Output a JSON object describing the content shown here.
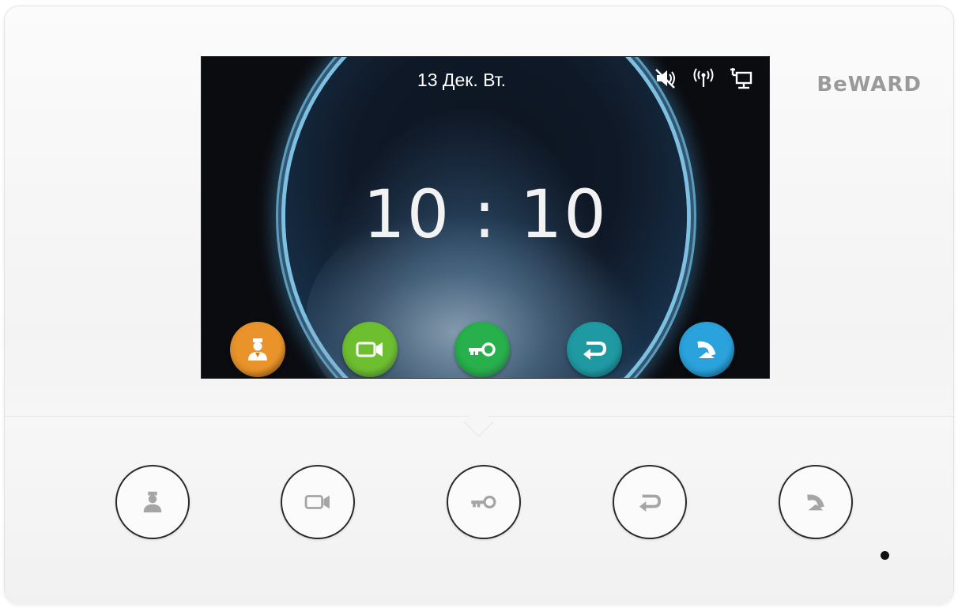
{
  "brand": "BeWARD",
  "screen": {
    "date": "13 Дек. Вт.",
    "time": "10 : 10",
    "status_icons": [
      "mute-icon",
      "wireless-antenna-icon",
      "network-lan-icon"
    ]
  },
  "screen_buttons": [
    {
      "name": "concierge",
      "icon": "concierge-icon",
      "color": "#e9932a"
    },
    {
      "name": "monitor",
      "icon": "video-camera-icon",
      "color": "#6dbf2f"
    },
    {
      "name": "unlock",
      "icon": "key-icon",
      "color": "#27b04b"
    },
    {
      "name": "transfer",
      "icon": "transfer-icon",
      "color": "#1f9aa2"
    },
    {
      "name": "hang-up",
      "icon": "hang-up-icon",
      "color": "#2aa2dc"
    }
  ],
  "hardware_buttons": [
    {
      "name": "concierge",
      "icon": "concierge-icon"
    },
    {
      "name": "monitor",
      "icon": "video-camera-icon"
    },
    {
      "name": "unlock",
      "icon": "key-icon"
    },
    {
      "name": "transfer",
      "icon": "transfer-icon"
    },
    {
      "name": "hang-up",
      "icon": "hang-up-icon"
    }
  ],
  "colors": {
    "device_body": "#f5f5f5",
    "screen_bg": "#0b0c10",
    "glow": "#8fd2f2",
    "brand_text": "#9a9a9a",
    "hw_icon": "#a5a5a5",
    "led": "#111111"
  }
}
